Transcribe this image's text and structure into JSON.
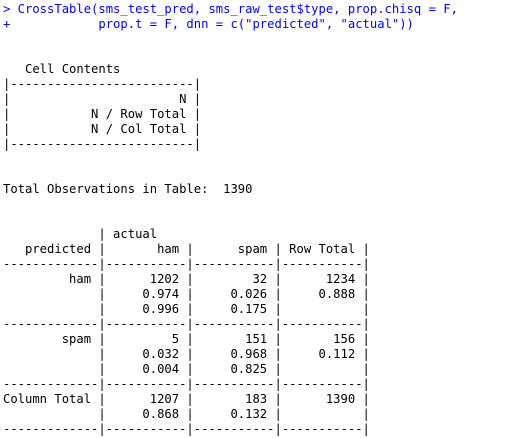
{
  "console": {
    "colors": {
      "command": "#0000ff",
      "output": "#000000",
      "background": "#ffffff"
    },
    "command_lines": [
      "> CrossTable(sms_test_pred, sms_raw_test$type, prop.chisq = F,",
      "+            prop.t = F, dnn = c(\"predicted\", \"actual\"))"
    ],
    "output_lines": [
      "",
      "",
      "   Cell Contents",
      "|-------------------------|",
      "|                       N |",
      "|           N / Row Total |",
      "|           N / Col Total |",
      "|-------------------------|",
      "",
      "",
      "Total Observations in Table:  1390",
      "",
      "",
      "             | actual",
      "   predicted |       ham |      spam | Row Total |",
      "-------------|-----------|-----------|-----------|",
      "         ham |      1202 |        32 |      1234 |",
      "             |     0.974 |     0.026 |     0.888 |",
      "             |     0.996 |     0.175 |           |",
      "-------------|-----------|-----------|-----------|",
      "        spam |         5 |       151 |       156 |",
      "             |     0.032 |     0.968 |     0.112 |",
      "             |     0.004 |     0.825 |           |",
      "-------------|-----------|-----------|-----------|",
      "Column Total |      1207 |       183 |      1390 |",
      "             |     0.868 |     0.132 |           |",
      "-------------|-----------|-----------|-----------|"
    ]
  }
}
